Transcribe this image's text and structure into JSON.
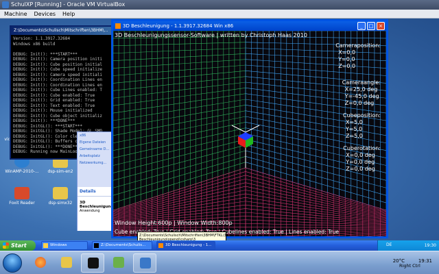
{
  "host": {
    "window_title": "SchulXP [Running] - Oracle VM VirtualBox",
    "menu": [
      "Machine",
      "Devices",
      "Help"
    ],
    "taskbar": {
      "temperature": "20°C",
      "clock": "19:31",
      "host_key": "Right Ctrl"
    }
  },
  "desktop": {
    "icons": [
      {
        "label": "magix-vid_editor_pro_..."
      },
      {
        "label": "WinAMP-2010-..."
      },
      {
        "label": "dsp-sim-en2"
      },
      {
        "label": "Foxit Reader"
      },
      {
        "label": "dsp-simx32"
      }
    ]
  },
  "console": {
    "title": "Z:\\Documents\\Schulisch\\Mitschriften\\3BHM\\...",
    "lines": [
      "Version: 1.1.3917.32684",
      "Windows x86 build",
      "",
      "DEBUG: Init(): ***START***",
      "DEBUG: Init(): Camera position initi",
      "DEBUG: Init(): Cube position initial",
      "DEBUG: Init(): Cube speed initialize",
      "DEBUG: Init(): Camera speed initiali",
      "DEBUG: Init(): Coordination Lines en",
      "DEBUG: Init(): Coordination Lines en",
      "DEBUG: Init(): Cube Lines enabled: T",
      "DEBUG: Init(): Cube enabled: True",
      "DEBUG: Init(): Grid enabled: True",
      "DEBUG: Init(): Text enabled: True",
      "DEBUG: Init(): Mouse initialized",
      "DEBUG: Init(): Cube object initializ",
      "DEBUG: Init(): ***DONE***",
      "DEBUG: InitGL(): ***START***",
      "DEBUG: InitGL(): Shade Model: GL_SMO",
      "DEBUG: InitGL(): Color cleared",
      "DEBUG: InitGL(): Buffers cleared",
      "DEBUG: InitGL(): ***DONE***",
      "DEBUG: Running now MainLoop()"
    ]
  },
  "explorer": {
    "items": [
      "x86",
      "Eigene Dateien",
      "Gemeinsame D...",
      "Arbeitsplatz",
      "Netzwerkumg..."
    ],
    "details_header": "Details",
    "details_name": "3D Beschleunigungs...",
    "details_type": "Anwendung"
  },
  "app": {
    "title": "3D Beschleunigung - 1.1.3917.32684 Win x86",
    "heading": "3D Beschleunigungssensor-Software | written by Christoph Haas 2010",
    "camera_position": {
      "label": "Cameraposition:",
      "x": "X=0,0",
      "y": "Y=0,0",
      "z": "Z=0,0"
    },
    "camera_angle": {
      "label": "Cameraangle:",
      "x": "X=25,0 deg",
      "y": "Y=-45,0 deg",
      "z": "Z=0,0 deg"
    },
    "cube_position": {
      "label": "Cubeposition:",
      "x": "X=5,0",
      "y": "Y=5,0",
      "z": "Z=5,0"
    },
    "cube_rotation": {
      "label": "Cuberotation:",
      "x": "X=0,0 deg",
      "y": "Y=0,0 deg",
      "z": "Z=0,0 deg"
    },
    "status_line1": "Window Height:600p    |    Window Width:800p",
    "status_line2": "Cube enabled: True  |  Grid enabled: True  |  Cubelines enabled: True  |  Lines enabled: True",
    "colors": {
      "grid_right": "#3ea0ee",
      "grid_left": "#2fae5a",
      "grid_floor": "#d2326e",
      "cube_top": "#1e3cff",
      "cube_front": "#e81c1c",
      "cube_side": "#1fb81f"
    }
  },
  "tooltip": {
    "text": "Z:\\Documents\\Schulisch\\Mitschriften\\3BHM\\FTKL\\3D Beschleunigung\\opengl\\csharp\\3"
  },
  "xp_taskbar": {
    "start_label": "Start",
    "tasks": [
      "Windows",
      "Z:\\Documents\\Schulis...",
      "3D Beschleunigung - 1..."
    ],
    "lang": "DE",
    "clock": "19:30"
  }
}
